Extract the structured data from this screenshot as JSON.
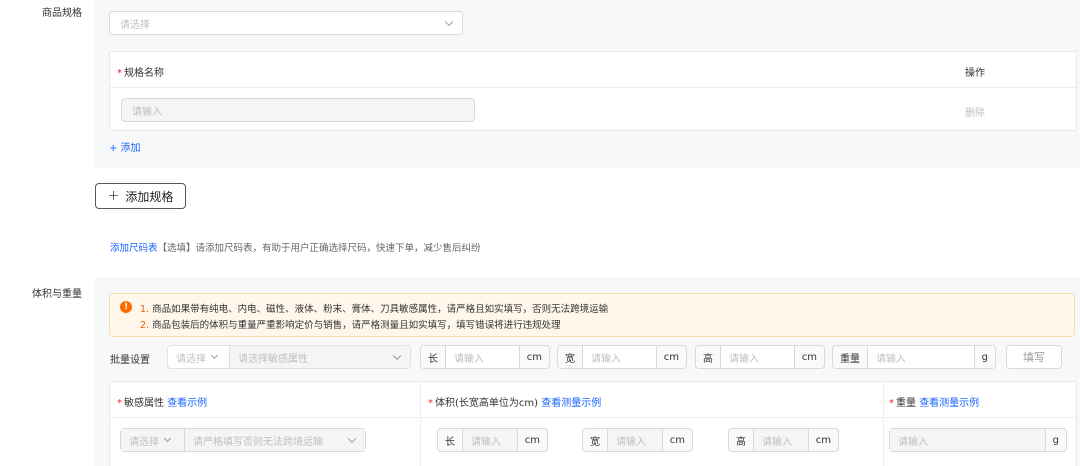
{
  "spec_section": {
    "label": "商品规格",
    "select_placeholder": "请选择",
    "table": {
      "col_name": "规格名称",
      "col_action": "操作",
      "row_input_placeholder": "请输入",
      "row_action": "删除"
    },
    "add_link": "+ 添加",
    "add_spec_button": "添加规格",
    "size_chart_link": "添加尺码表",
    "size_chart_hint": "【选填】请添加尺码表，有助于用户正确选择尺码，快速下单，减少售后纠纷"
  },
  "volume_section": {
    "label": "体积与重量",
    "alert": {
      "line1_num": "1.",
      "line1_text": "商品如果带有纯电、内电、磁性、液体、粉末、膏体、刀具敏感属性，请严格且如实填写，否则无法跨境运输",
      "line2_num": "2.",
      "line2_text": "商品包装后的体积与重量严重影响定价与销售，请严格测量且如实填写，填写错误将进行违规处理"
    },
    "batch": {
      "label": "批量设置",
      "select_placeholder": "请选择",
      "sensitive_placeholder": "请选择敏感属性",
      "length_label": "长",
      "width_label": "宽",
      "height_label": "高",
      "weight_label": "重量",
      "input_placeholder": "请输入",
      "unit_cm": "cm",
      "unit_g": "g",
      "fill_button": "填写"
    },
    "table": {
      "col_sensitive": "敏感属性",
      "col_sensitive_link": "查看示例",
      "col_volume": "体积(长宽高单位为cm)",
      "col_volume_link": "查看测量示例",
      "col_weight": "重量",
      "col_weight_link": "查看测量示例",
      "row_select_placeholder": "请选择",
      "row_sensitive_placeholder": "请严格填写否则无法跨境运输",
      "length_label": "长",
      "width_label": "宽",
      "height_label": "高",
      "input_placeholder": "请输入",
      "unit_cm": "cm",
      "unit_g": "g"
    }
  },
  "colors": {
    "link": "#1966ff",
    "required": "#f5222d",
    "alert_bg": "#fff7ec",
    "alert_icon": "#ff6a00"
  }
}
